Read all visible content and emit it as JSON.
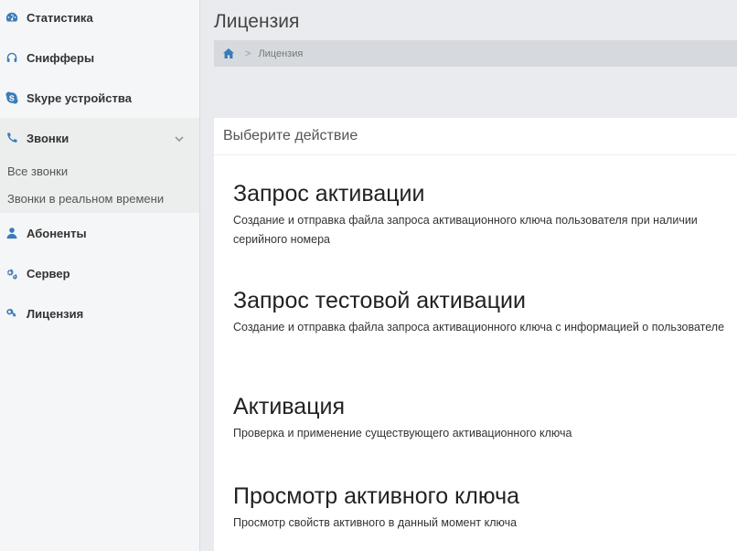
{
  "sidebar": {
    "items": [
      {
        "label": "Статистика",
        "icon": "dashboard-icon"
      },
      {
        "label": "Снифферы",
        "icon": "headphones-icon"
      },
      {
        "label": "Skype устройства",
        "icon": "skype-icon"
      },
      {
        "label": "Звонки",
        "icon": "phone-icon",
        "expanded": true
      },
      {
        "label": "Абоненты",
        "icon": "user-icon"
      },
      {
        "label": "Сервер",
        "icon": "gears-icon"
      },
      {
        "label": "Лицензия",
        "icon": "key-icon"
      }
    ],
    "calls_submenu": [
      {
        "label": "Все звонки"
      },
      {
        "label": "Звонки в реальном времени"
      }
    ]
  },
  "main": {
    "title": "Лицензия",
    "breadcrumb": {
      "separator": ">",
      "current": "Лицензия"
    },
    "panel": {
      "header": "Выберите действие",
      "actions": [
        {
          "title": "Запрос активации",
          "description": "Создание и отправка файла запроса активационного ключа пользователя при наличии серийного номера"
        },
        {
          "title": "Запрос тестовой активации",
          "description": "Создание и отправка файла запроса активационного ключа с информацией о пользователе"
        },
        {
          "title": "Активация",
          "description": "Проверка и применение существующего активационного ключа"
        },
        {
          "title": "Просмотр активного ключа",
          "description": "Просмотр свойств активного в данный момент ключа"
        }
      ]
    }
  },
  "colors": {
    "accent": "#3a7bb8",
    "sidebar_bg": "#f5f6f7",
    "breadcrumb_bg": "#d6dade",
    "page_bg": "#e9ebee"
  }
}
